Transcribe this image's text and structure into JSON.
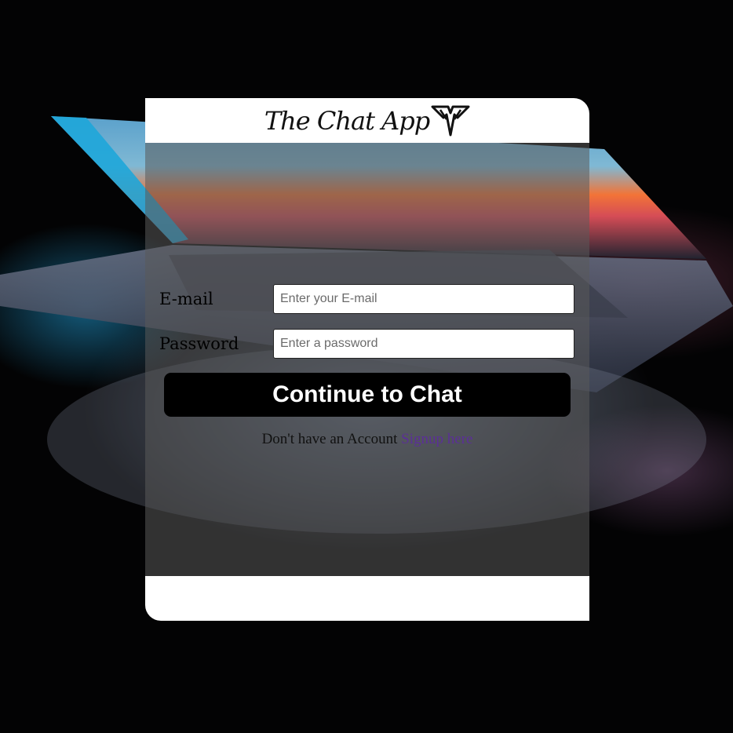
{
  "app": {
    "logo_text": "The Chat App",
    "logo_icon": "chevron-wings-icon"
  },
  "form": {
    "email_label": "E-mail",
    "email_placeholder": "Enter your E-mail",
    "email_value": "",
    "password_label": "Password",
    "password_placeholder": "Enter a password",
    "password_value": "",
    "submit_label": "Continue to Chat"
  },
  "signup": {
    "prompt": "Don't have an Account",
    "link_label": "Signup here"
  },
  "colors": {
    "button_bg": "#000000",
    "button_text": "#ffffff",
    "link": "#5b2f97",
    "overlay": "rgba(90,90,90,0.55)"
  }
}
